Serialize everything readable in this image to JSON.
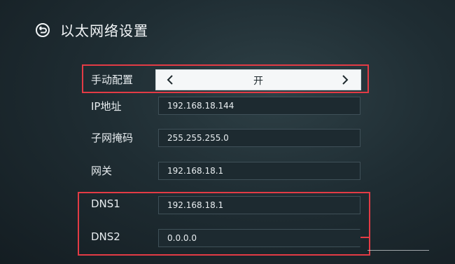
{
  "header": {
    "title": "以太网络设置",
    "back_icon": "back-icon"
  },
  "manual_config": {
    "label": "手动配置",
    "value": "开",
    "left_icon": "chevron-left-icon",
    "right_icon": "chevron-right-icon"
  },
  "fields": [
    {
      "label": "IP地址",
      "value": "192.168.18.144"
    },
    {
      "label": "子网掩码",
      "value": "255.255.255.0"
    },
    {
      "label": "网关",
      "value": "192.168.18.1"
    },
    {
      "label": "DNS1",
      "value": "192.168.18.1"
    },
    {
      "label": "DNS2",
      "value": "0.0.0.0"
    }
  ],
  "colors": {
    "highlight": "#e33b45",
    "selector_bg": "#f5f7f8",
    "field_bg": "#1d2a30"
  }
}
